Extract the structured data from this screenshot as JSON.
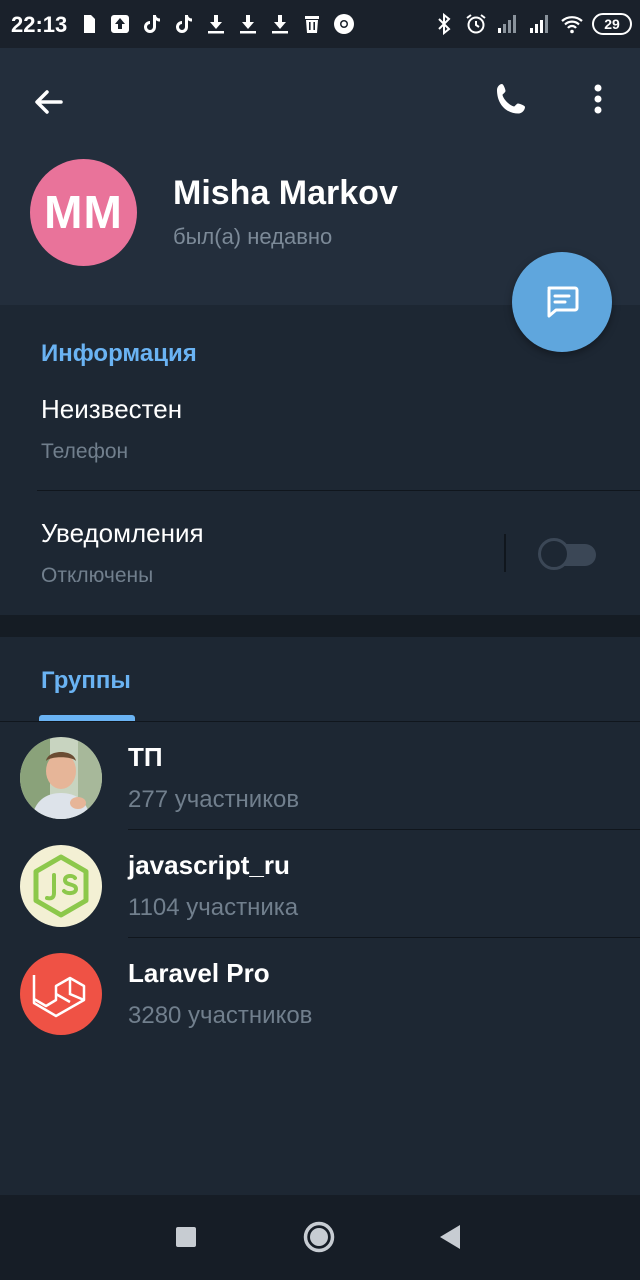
{
  "status_bar": {
    "time": "22:13",
    "battery": "29",
    "left_icons": [
      "sim-icon",
      "upload-icon",
      "tiktok-icon",
      "tiktok-icon",
      "download-icon",
      "download-icon",
      "download-icon",
      "trash-icon",
      "chrome-icon"
    ],
    "right_icons": [
      "bluetooth-icon",
      "alarm-icon",
      "signal-icon",
      "signal-icon",
      "wifi-icon",
      "battery-icon"
    ]
  },
  "header": {
    "avatar_initials": "MM",
    "avatar_color": "#e9739a",
    "name": "Misha Markov",
    "status": "был(а) недавно",
    "actions": [
      "back-arrow-icon",
      "phone-icon",
      "more-vertical-icon"
    ]
  },
  "fab": {
    "icon": "message-icon",
    "color": "#5fa6dd"
  },
  "info": {
    "title": "Информация",
    "phone": {
      "value": "Неизвестен",
      "label": "Телефон"
    },
    "notifications": {
      "value": "Уведомления",
      "label": "Отключены",
      "enabled": false
    }
  },
  "groups": {
    "tab_label": "Группы",
    "items": [
      {
        "name": "ТП",
        "members": "277 участников",
        "avatar": "photo"
      },
      {
        "name": "javascript_ru",
        "members": "1104 участника",
        "avatar": "js-logo-icon"
      },
      {
        "name": "Laravel Pro",
        "members": "3280 участников",
        "avatar": "laravel-logo-icon"
      }
    ]
  },
  "nav_bar": {
    "buttons": [
      "recents-square-icon",
      "home-circle-icon",
      "back-triangle-icon"
    ]
  },
  "colors": {
    "accent": "#6ab3f3",
    "background": "#1d2733",
    "header": "#232e3c"
  }
}
